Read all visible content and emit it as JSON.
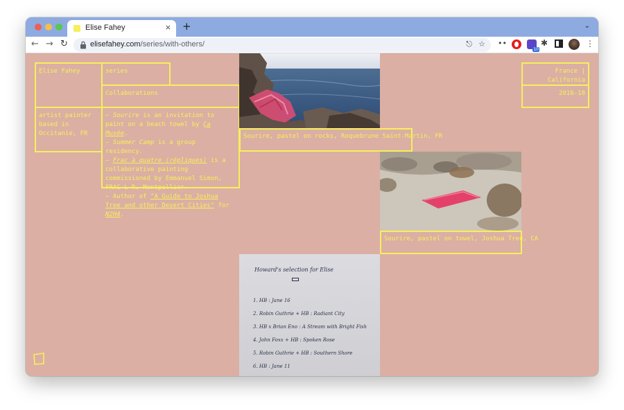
{
  "browser": {
    "tab_title": "Elise Fahey",
    "new_tab": "+",
    "tab_close": "×",
    "url_host": "elisefahey.com",
    "url_path": "/series/with-others/",
    "accent_color": "#8dabe0",
    "extension_badge": "10"
  },
  "site": {
    "name": "Elise Fahey",
    "bio": "artist painter based in Occitanie, FR",
    "nav_series": "series",
    "section_title": "Collaborations",
    "location": "France | California",
    "years": "2016-18",
    "theme_color": "#f7ef5c",
    "background_color": "#dbafa3"
  },
  "description": {
    "line1_prefix": "— ",
    "sourire": "Sourire",
    "line1_mid": " is an invitation to paint on a beach towel by ",
    "ca_musee": "Ça Musée",
    "line1_end": ".",
    "line2_prefix": "— ",
    "summer_camp": "Summer Camp",
    "line2_rest": " is a group residency.",
    "line3_prefix": "— ",
    "frac": "Frac à quatre (répliques)",
    "line3_rest": " is a collaborative painting commissioned by Emmanuel Simon, FRAC L-R, Montpellier.",
    "line4_prefix": "— Author of ",
    "guide": "\"A Guide to Joshua Tree and other Desert Cities\"",
    "line4_mid": " for ",
    "n2h4": "N2H4",
    "line4_end": "."
  },
  "works": [
    {
      "caption": "Sourire, pastel on rocks, Roquebrune Saint-Martin, FR"
    },
    {
      "caption": "Sourire, pastel on towel, Joshua Tree, CA"
    },
    {
      "caption": ""
    }
  ],
  "letter": {
    "heading": "Howard's selection for Elise",
    "items": [
      "1. HB : Jane 16",
      "2. Robin Guthrie + HB : Radiant City",
      "3. HB x Brian Eno : A Stream with Bright Fish",
      "4. John Foxx + HB : Spoken Rose",
      "5. Robin Guthrie + HB : Southern Shore",
      "6. HB : Jane 11"
    ]
  }
}
